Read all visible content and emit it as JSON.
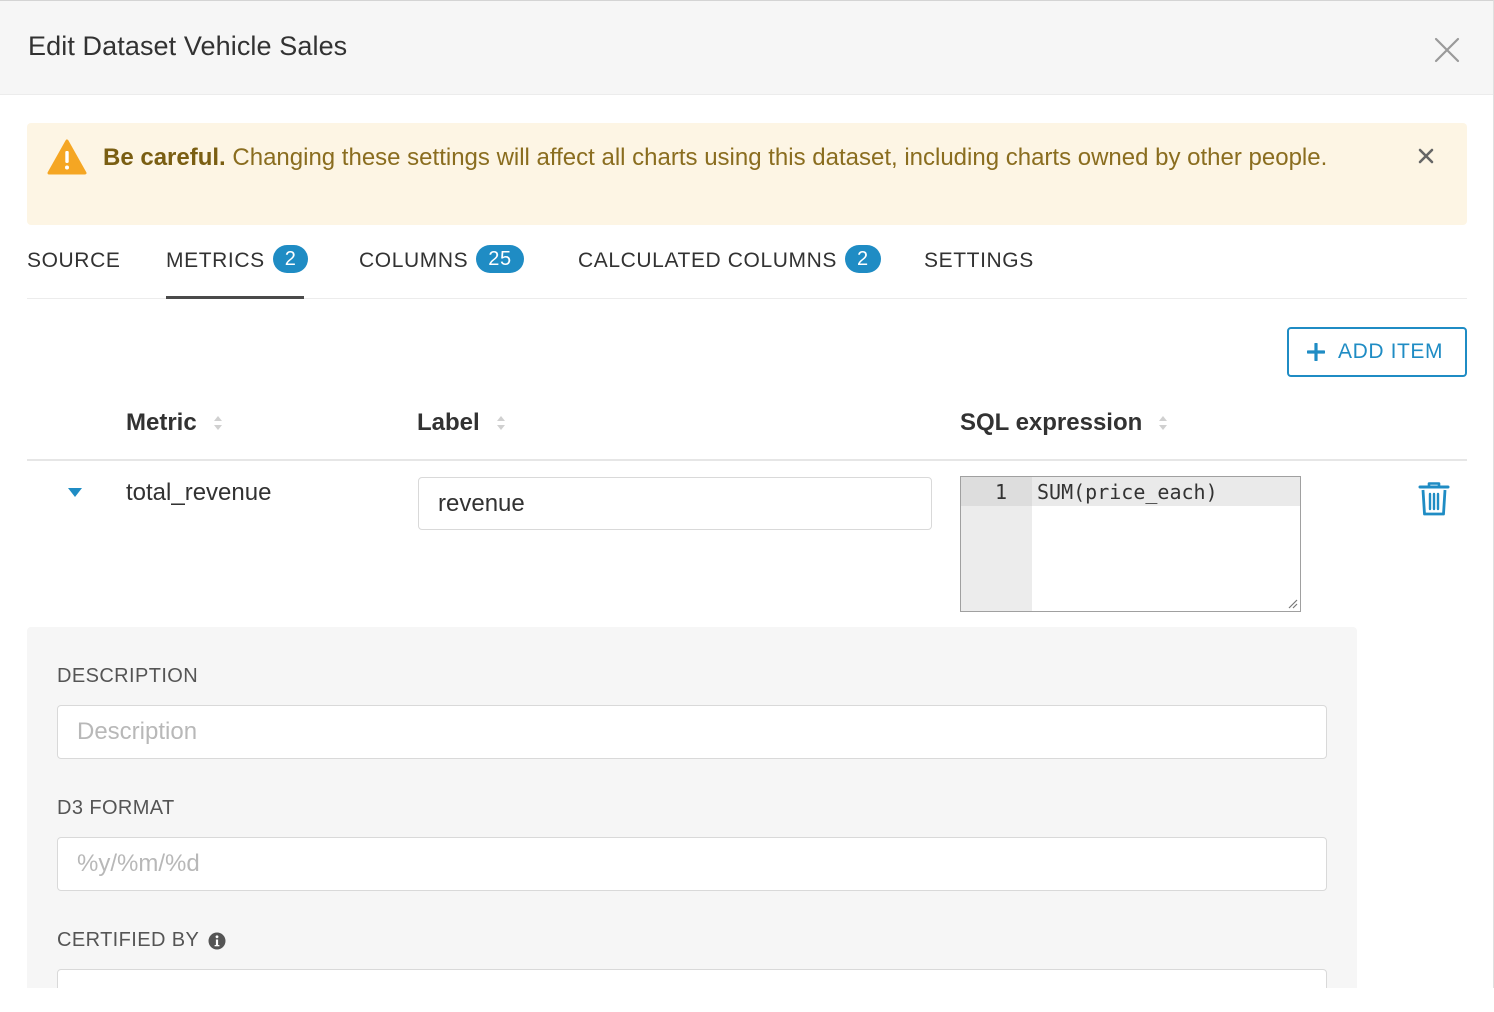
{
  "header": {
    "title": "Edit Dataset Vehicle Sales"
  },
  "alert": {
    "bold": "Be careful.",
    "message": " Changing these settings will affect all charts using this dataset, including charts owned by other people."
  },
  "tabs": [
    {
      "label": "SOURCE",
      "badge": null
    },
    {
      "label": "METRICS",
      "badge": "2"
    },
    {
      "label": "COLUMNS",
      "badge": "25"
    },
    {
      "label": "CALCULATED COLUMNS",
      "badge": "2"
    },
    {
      "label": "SETTINGS",
      "badge": null
    }
  ],
  "active_tab": "METRICS",
  "toolbar": {
    "add_item_label": "ADD ITEM"
  },
  "table": {
    "headers": {
      "metric": "Metric",
      "label": "Label",
      "sql": "SQL expression"
    },
    "row": {
      "metric": "total_revenue",
      "label_value": "revenue",
      "sql_line_number": "1",
      "sql_code": "SUM(price_each)"
    }
  },
  "details": {
    "description_label": "DESCRIPTION",
    "description_placeholder": "Description",
    "d3_label": "D3 FORMAT",
    "d3_placeholder": "%y/%m/%d",
    "certified_label": "CERTIFIED BY"
  },
  "colors": {
    "accent": "#1f8cc4",
    "warning_bg": "#fdf5e4",
    "warning_text": "#8a6d1f",
    "warning_icon": "#f5a623"
  }
}
